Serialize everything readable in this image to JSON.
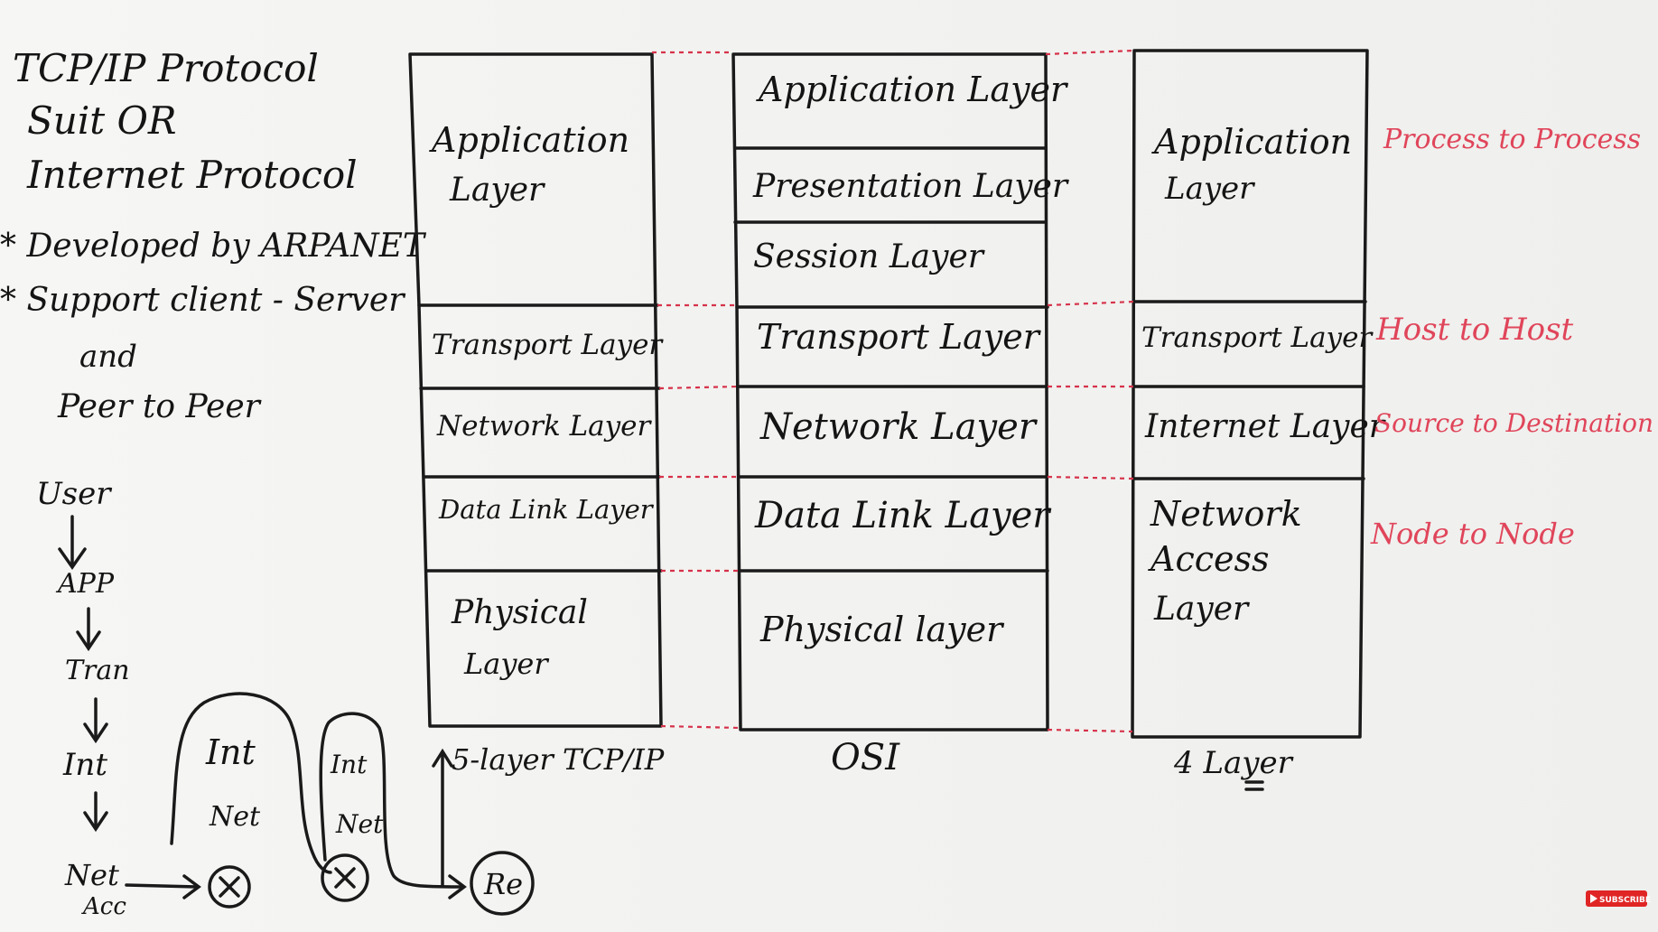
{
  "title": {
    "line1": "TCP/IP Protocol",
    "line2": "Suit    OR",
    "line3": "Internet Protocol"
  },
  "bullets": [
    "* Developed by ARPANET",
    "* Support client - Server",
    "and",
    "Peer to Peer"
  ],
  "flow": {
    "steps": [
      "User",
      "APP",
      "Tran",
      "Int",
      "Net",
      "Acc"
    ],
    "loop1_labels": [
      "Int",
      "Net"
    ],
    "loop2_labels": [
      "Int",
      "Net"
    ],
    "receiver": "Re"
  },
  "stacks": {
    "tcpip5": {
      "label": "5-layer TCP/IP",
      "layers": [
        [
          "Application",
          "Layer"
        ],
        [
          "Transport Layer"
        ],
        [
          "Network Layer"
        ],
        [
          "Data Link Layer"
        ],
        [
          "Physical",
          "Layer"
        ]
      ]
    },
    "osi": {
      "label": "OSI",
      "layers": [
        [
          "Application Layer"
        ],
        [
          "Presentation Layer"
        ],
        [
          "Session Layer"
        ],
        [
          "Transport Layer"
        ],
        [
          "Network Layer"
        ],
        [
          "Data Link Layer"
        ],
        [
          "Physical layer"
        ]
      ]
    },
    "tcpip4": {
      "label": "4 Layer",
      "layers": [
        [
          "Application",
          "Layer"
        ],
        [
          "Transport Layer"
        ],
        [
          "Internet Layer"
        ],
        [
          "Network",
          "Access",
          "Layer"
        ]
      ]
    }
  },
  "annotations": [
    "Process to Process",
    "Host to Host",
    "Source to Destination",
    "Node to Node"
  ],
  "badge": {
    "label": "SUBSCRIBE"
  },
  "colors": {
    "ink": "#1a1a1a",
    "marker_red": "#e0455a",
    "board": "#f3f3f1"
  }
}
